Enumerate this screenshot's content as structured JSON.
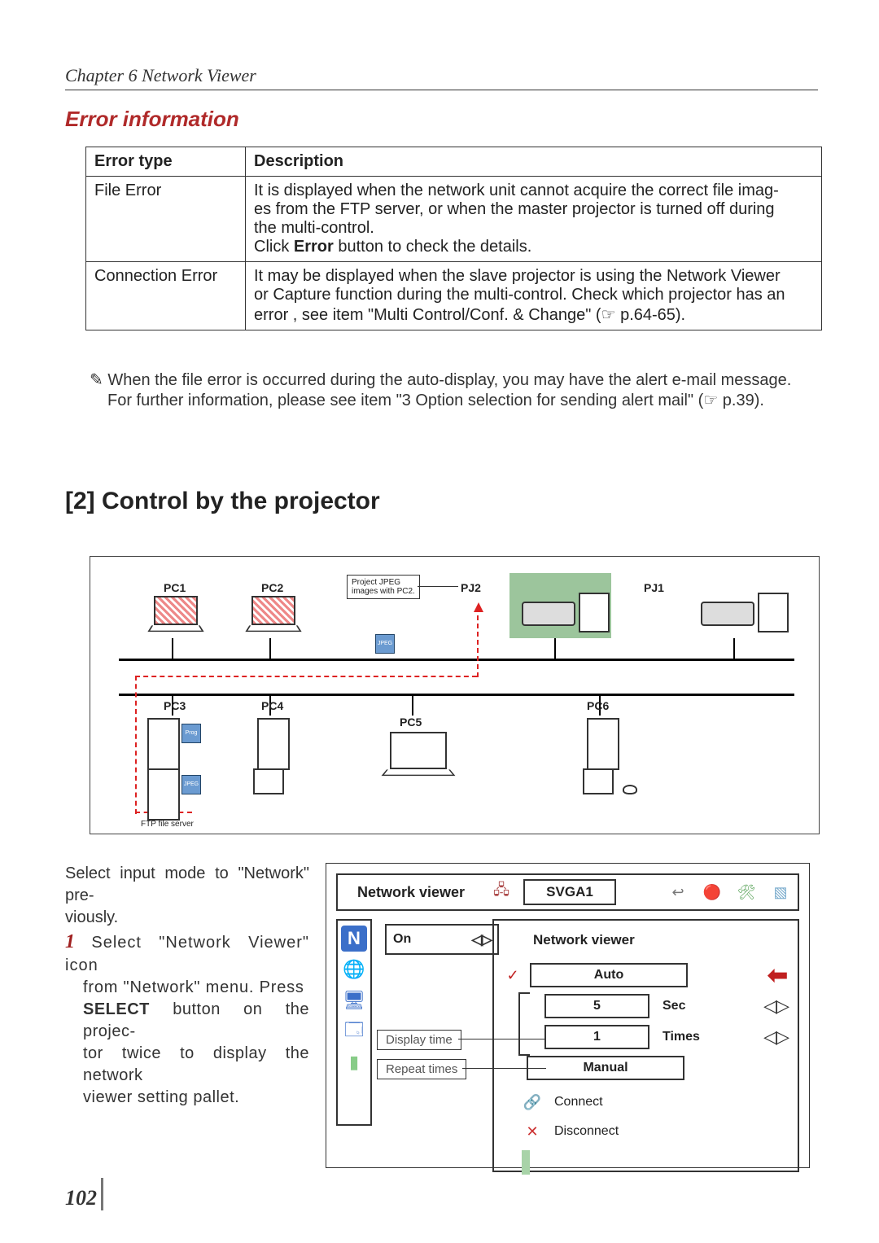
{
  "chapter": "Chapter 6 Network Viewer",
  "section1_title": "Error information",
  "error_table": {
    "headers": [
      "Error type",
      "Description"
    ],
    "rows": [
      {
        "type": "File Error",
        "desc_l1": "It is displayed when the network unit cannot acquire the correct file imag-",
        "desc_l2": "es from the FTP server, or when the master projector is turned off during",
        "desc_l3": "the multi-control.",
        "desc_l4_pre": "Click ",
        "desc_l4_b": "Error",
        "desc_l4_post": " button to check the details."
      },
      {
        "type": "Connection Error",
        "desc_l1": "It may be displayed when the slave projector is using the Network Viewer",
        "desc_l2": "or Capture function during the multi-control. Check which projector has an",
        "desc_l3": "error , see item \"Multi Control/Conf. & Change\" (☞ p.64-65)."
      }
    ]
  },
  "note_bullet": "✎",
  "note_l1": "When the file error is occurred during the auto-display, you may have the alert e-mail message.",
  "note_l2": "For further information, please see item \"3 Option selection for sending alert mail\" (☞ p.39).",
  "section2_title": "[2] Control by the projector",
  "diagram": {
    "pc1": "PC1",
    "pc2": "PC2",
    "pc3": "PC3",
    "pc4": "PC4",
    "pc5": "PC5",
    "pc6": "PC6",
    "pj1": "PJ1",
    "pj2": "PJ2",
    "callout_l1": "Project JPEG",
    "callout_l2": "images with PC2.",
    "ftp_label": "FTP file server",
    "jpeg": "JPEG",
    "prog": "Prog"
  },
  "instr": {
    "pre_l1": "Select input mode to \"Network\" pre-",
    "pre_l2": "viously.",
    "step_num": "1",
    "s1": "Select \"Network Viewer\" icon",
    "s2": "from \"Network\" menu. Press",
    "s3_pre": "",
    "s3_b": "SELECT",
    "s3_post": " button on the projec-",
    "s4": "tor twice to display the network",
    "s5": "viewer setting pallet."
  },
  "menu": {
    "title": "Network viewer",
    "svga": "SVGA1",
    "on": "On",
    "panel_title": "Network viewer",
    "auto": "Auto",
    "sec_val": "5",
    "sec_label": "Sec",
    "times_val": "1",
    "times_label": "Times",
    "manual": "Manual",
    "connect": "Connect",
    "disconnect": "Disconnect",
    "callout_display": "Display time",
    "callout_repeat": "Repeat times"
  },
  "page_number": "102"
}
